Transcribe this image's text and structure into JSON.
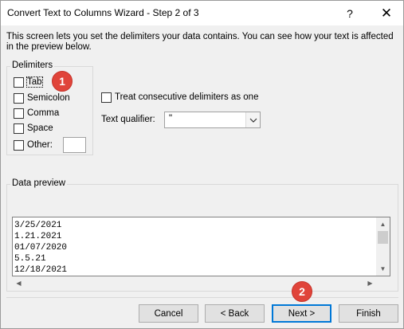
{
  "window": {
    "title": "Convert Text to Columns Wizard - Step 2 of 3",
    "help_glyph": "?",
    "close_glyph": "✕"
  },
  "description": "This screen lets you set the delimiters your data contains.  You can see how your text is affected in the preview below.",
  "delimiters": {
    "group_label": "Delimiters",
    "items": [
      {
        "label": "Tab",
        "checked": false
      },
      {
        "label": "Semicolon",
        "checked": false
      },
      {
        "label": "Comma",
        "checked": false
      },
      {
        "label": "Space",
        "checked": false
      },
      {
        "label": "Other:",
        "checked": false
      }
    ],
    "other_value": ""
  },
  "options": {
    "consecutive_label": "Treat consecutive delimiters as one",
    "consecutive_checked": false,
    "qualifier_label": "Text qualifier:",
    "qualifier_value": "\""
  },
  "preview": {
    "group_label": "Data preview",
    "lines": [
      "3/25/2021",
      "1.21.2021",
      "01/07/2020",
      "5.5.21",
      "12/18/2021"
    ]
  },
  "buttons": {
    "cancel": "Cancel",
    "back": "< Back",
    "next": "Next >",
    "finish": "Finish"
  },
  "annotations": {
    "badge1": "1",
    "badge2": "2",
    "badge_color": "#e0443a"
  },
  "icons": {
    "dropdown": "chevron-down-icon",
    "scroll_up": "triangle-up-icon",
    "scroll_down": "triangle-down-icon",
    "scroll_left": "triangle-left-icon",
    "scroll_right": "triangle-right-icon"
  }
}
